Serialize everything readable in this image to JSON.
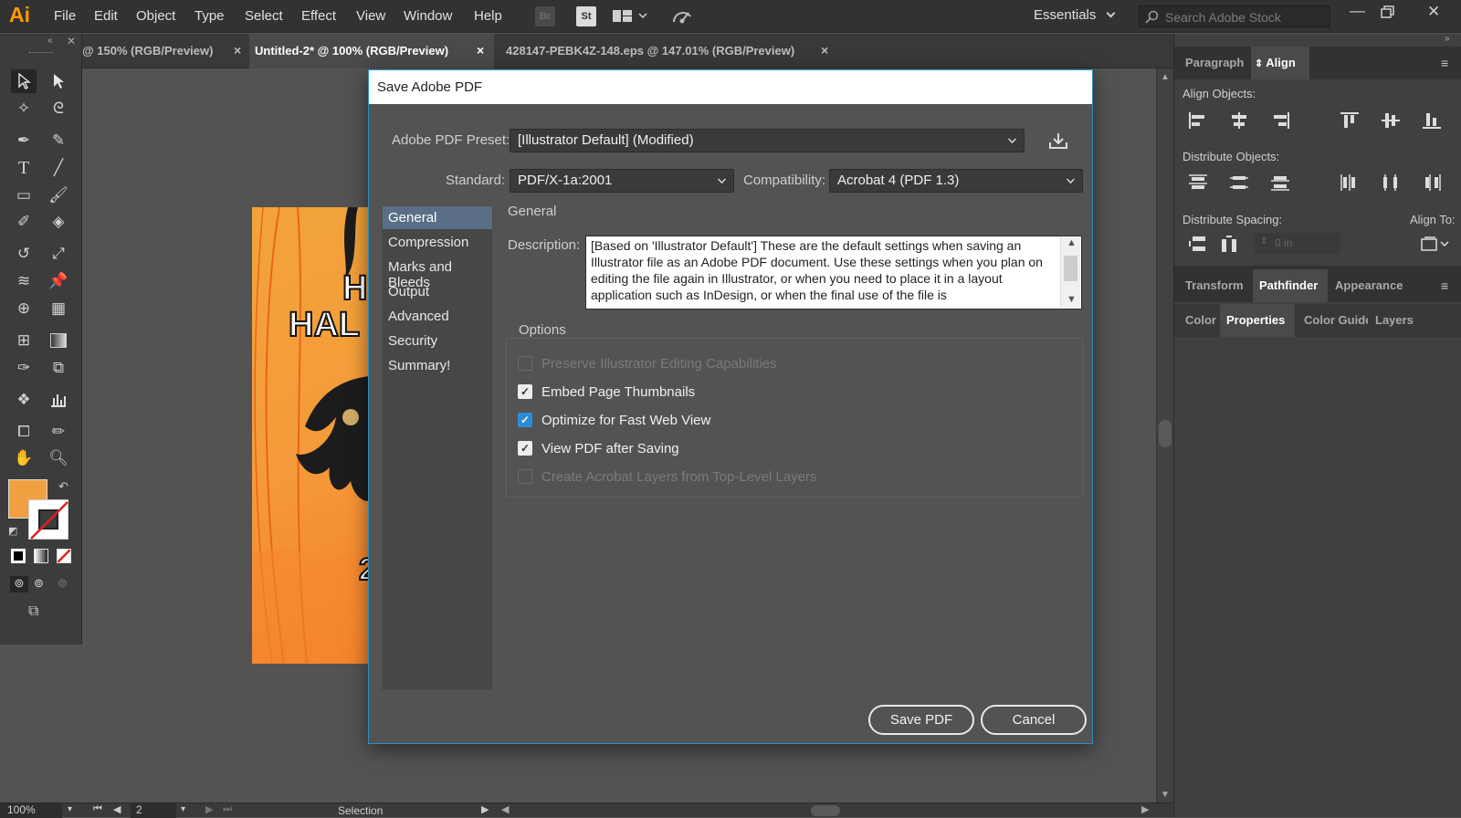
{
  "app": {
    "logo": "Ai",
    "menu": [
      "File",
      "Edit",
      "Object",
      "Type",
      "Select",
      "Effect",
      "View",
      "Window",
      "Help"
    ],
    "toolbar_icons": {
      "bridge": "Br",
      "stock": "St"
    },
    "workspace": "Essentials",
    "search_placeholder": "Search Adobe Stock",
    "accent": "#ff9a00"
  },
  "tabs": [
    {
      "label": "@ 150% (RGB/Preview)",
      "active": false
    },
    {
      "label": "Untitled-2* @ 100% (RGB/Preview)",
      "active": true
    },
    {
      "label": "428147-PEBK4Z-148.eps @ 147.01% (RGB/Preview)",
      "active": false
    }
  ],
  "tab_close": "×",
  "artwork": {
    "line1": "H",
    "line2": "HAL",
    "line3": "2"
  },
  "right_panel": {
    "top_tabs": [
      "Paragraph",
      "Align"
    ],
    "align_objects_label": "Align Objects:",
    "distribute_objects_label": "Distribute Objects:",
    "distribute_spacing_label": "Distribute Spacing:",
    "align_to_label": "Align To:",
    "spacing_value": "0 in",
    "mid_tabs": [
      "Transform",
      "Pathfinder",
      "Appearance"
    ],
    "bottom_tabs": [
      "Color",
      "Properties",
      "Color Guide",
      "Layers"
    ]
  },
  "status": {
    "zoom": "100%",
    "page": "2",
    "tool": "Selection"
  },
  "dialog": {
    "title": "Save Adobe PDF",
    "preset_label": "Adobe PDF Preset:",
    "preset_value": "[Illustrator Default] (Modified)",
    "standard_label": "Standard:",
    "standard_value": "PDF/X-1a:2001",
    "compat_label": "Compatibility:",
    "compat_value": "Acrobat 4 (PDF 1.3)",
    "nav": [
      "General",
      "Compression",
      "Marks and Bleeds",
      "Output",
      "Advanced",
      "Security",
      "Summary!"
    ],
    "section_title": "General",
    "description_label": "Description:",
    "description": "[Based on 'Illustrator Default'] These are the default settings when saving an Illustrator file as an Adobe PDF document. Use these settings when you plan on editing the file again in Illustrator, or when you need to place it in a layout application such as InDesign, or when the final use of the file is",
    "options_title": "Options",
    "options": [
      {
        "label": "Preserve Illustrator Editing Capabilities",
        "checked": false,
        "enabled": false
      },
      {
        "label": "Embed Page Thumbnails",
        "checked": true,
        "enabled": true
      },
      {
        "label": "Optimize for Fast Web View",
        "checked": true,
        "enabled": true
      },
      {
        "label": "View PDF after Saving",
        "checked": true,
        "enabled": true
      },
      {
        "label": "Create Acrobat Layers from Top-Level Layers",
        "checked": false,
        "enabled": false
      }
    ],
    "save_button": "Save PDF",
    "cancel_button": "Cancel"
  }
}
